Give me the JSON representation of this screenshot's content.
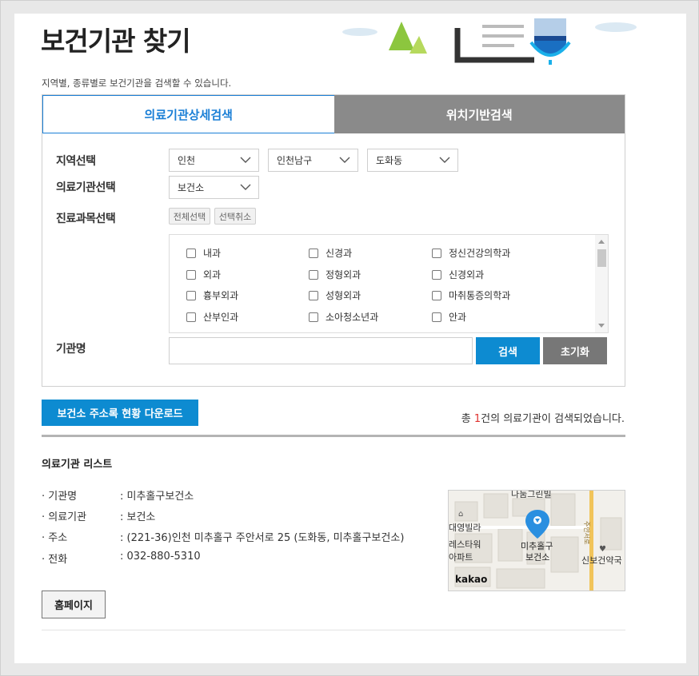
{
  "header": {
    "title": "보건기관 찾기",
    "description": "지역별, 종류별로 보건기관을 검색할 수 있습니다."
  },
  "tabs": [
    {
      "label": "의료기관상세검색",
      "active": true
    },
    {
      "label": "위치기반검색",
      "active": false
    }
  ],
  "form": {
    "region_label": "지역선택",
    "region_values": [
      "인천",
      "인천남구",
      "도화동"
    ],
    "institution_label": "의료기관선택",
    "institution_value": "보건소",
    "subject_label": "진료과목선택",
    "select_all": "전체선택",
    "deselect": "선택취소",
    "subjects": [
      [
        "내과",
        "신경과",
        "정신건강의학과"
      ],
      [
        "외과",
        "정형외과",
        "신경외과"
      ],
      [
        "흉부외과",
        "성형외과",
        "마취통증의학과"
      ],
      [
        "산부인과",
        "소아청소년과",
        "안과"
      ]
    ],
    "name_label": "기관명",
    "name_value": "",
    "search_button": "검색",
    "reset_button": "초기화"
  },
  "download_button": "보건소 주소록 현황 다운로드",
  "result": {
    "prefix": "총 ",
    "count": "1",
    "suffix": "건의 의료기관이 검색되었습니다."
  },
  "list": {
    "title": "의료기관 리스트",
    "rows": [
      {
        "key": "기관명",
        "value": "미추홀구보건소"
      },
      {
        "key": "의료기관",
        "value": "보건소"
      },
      {
        "key": "주소",
        "value": "(221-36)인천 미추홀구 주안서로 25 (도화동, 미추홀구보건소)"
      },
      {
        "key": "전화",
        "value": "032-880-5310"
      }
    ],
    "homepage_button": "홈페이지"
  },
  "map": {
    "labels": {
      "top": "나눔그린빌",
      "villa": "대영빌라",
      "tower1": "레스타워",
      "tower2": "아파트",
      "marker_name1": "미추홀구",
      "marker_name2": "보건소",
      "pharmacy": "신보건약국",
      "road": "주안서로",
      "brand": "kakao"
    }
  },
  "colors": {
    "accent": "#0d8bd1",
    "tab_active_text": "#1a7fd6",
    "tab_inactive_bg": "#8a8a8a",
    "count": "#e0322e"
  }
}
